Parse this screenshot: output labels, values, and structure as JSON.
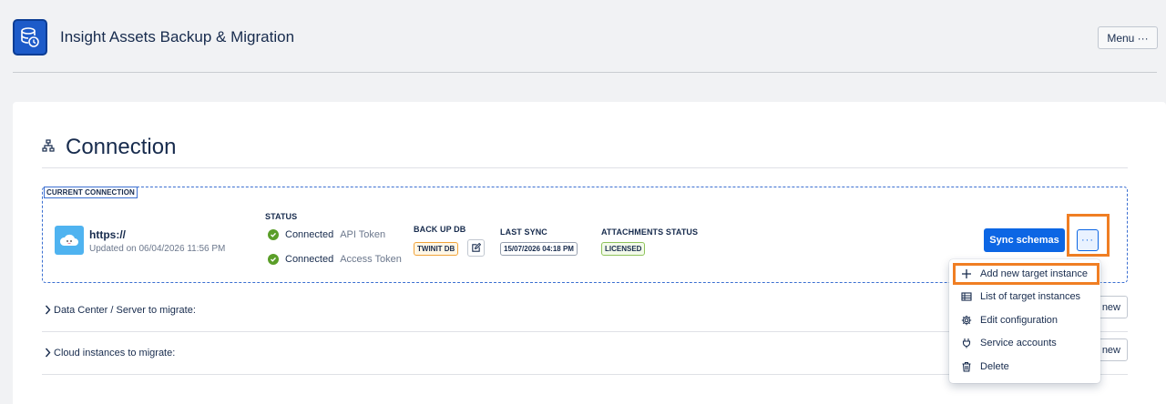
{
  "app": {
    "title": "Insight Assets Backup & Migration",
    "menu_label": "Menu ···"
  },
  "section": {
    "title": "Connection"
  },
  "connection": {
    "tag": "CURRENT CONNECTION",
    "url": "https://",
    "updated": "Updated on 06/04/2026 11:56 PM",
    "status_label": "STATUS",
    "status": [
      {
        "state": "Connected",
        "kind": "API Token"
      },
      {
        "state": "Connected",
        "kind": "Access Token"
      }
    ],
    "backup_label": "BACK UP DB",
    "backup_value": "TWINIT DB",
    "last_sync_label": "LAST SYNC",
    "last_sync_value": "15/07/2026 04:18 PM",
    "attachments_label": "ATTACHMENTS STATUS",
    "attachments_value": "LICENSED",
    "sync_button": "Sync schemas",
    "more_button": "···"
  },
  "sections": [
    {
      "label": "Data Center / Server to migrate:",
      "button": "new"
    },
    {
      "label": "Cloud instances to migrate:",
      "button": "new"
    }
  ],
  "dropdown": {
    "items": [
      {
        "label": "Add new target instance",
        "icon": "plus-icon"
      },
      {
        "label": "List of target instances",
        "icon": "table-icon"
      },
      {
        "label": "Edit configuration",
        "icon": "gear-icon"
      },
      {
        "label": "Service accounts",
        "icon": "plug-icon"
      },
      {
        "label": "Delete",
        "icon": "trash-icon"
      }
    ]
  },
  "colors": {
    "accent": "#0c66e4",
    "highlight": "#f07e23",
    "success": "#5a9e28"
  }
}
